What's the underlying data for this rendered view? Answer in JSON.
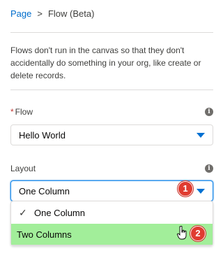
{
  "breadcrumb": {
    "parent": "Page",
    "separator": ">",
    "current": "Flow (Beta)"
  },
  "info_text": "Flows don't run in the canvas so that they don't accidentally do something in your org, like create or delete records.",
  "flow_field": {
    "required_mark": "*",
    "label": "Flow",
    "value": "Hello World",
    "info_icon": "info-icon"
  },
  "layout_field": {
    "label": "Layout",
    "value": "One Column",
    "info_icon": "info-icon",
    "options": [
      {
        "label": "One Column",
        "selected": true
      },
      {
        "label": "Two Columns",
        "highlighted": true
      }
    ]
  },
  "annotations": {
    "step1": "1",
    "step2": "2"
  },
  "colors": {
    "link": "#006dcc",
    "accent": "#0070d2",
    "highlight": "#a2ee9a",
    "badge": "#e03c31",
    "required": "#c23934"
  }
}
